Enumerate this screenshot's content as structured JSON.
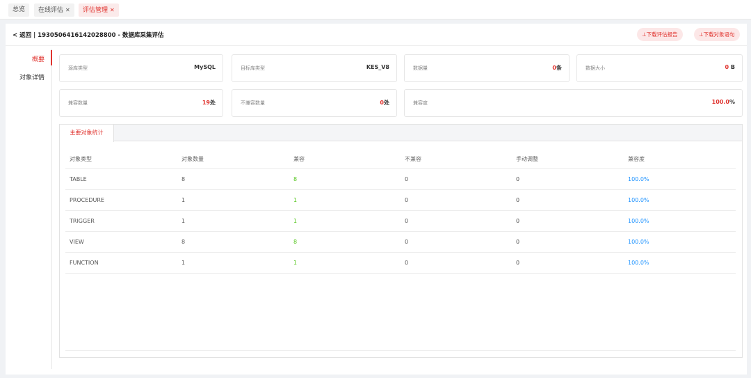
{
  "tabs": [
    {
      "label": "总览",
      "closable": false,
      "active": false
    },
    {
      "label": "在线评估",
      "closable": true,
      "active": false
    },
    {
      "label": "评估管理",
      "closable": true,
      "active": true
    }
  ],
  "header": {
    "back_label": "返回",
    "separator": "|",
    "title": "1930506416142028800 - 数据库采集评估",
    "buttons": {
      "download_report": "⊥下载评估报告",
      "download_objects": "⊥下载对象语句"
    }
  },
  "nav": {
    "items": [
      {
        "label": "概要",
        "active": true
      },
      {
        "label": "对象详情",
        "active": false
      }
    ]
  },
  "summary": {
    "source_db_type": {
      "label": "源库类型",
      "value": "MySQL"
    },
    "target_db_type": {
      "label": "目标库类型",
      "value": "KES_V8"
    },
    "data_volume": {
      "label": "数据量",
      "number": "0",
      "unit": "条"
    },
    "data_size": {
      "label": "数据大小",
      "number": "0",
      "unit": " B"
    },
    "compatible_count": {
      "label": "兼容数量",
      "number": "19",
      "unit": "处"
    },
    "incompatible_count": {
      "label": "不兼容数量",
      "number": "0",
      "unit": "处"
    },
    "compatibility": {
      "label": "兼容度",
      "number": "100.0",
      "unit": "%"
    }
  },
  "stats": {
    "tab_label": "主要对象统计",
    "columns": [
      "对象类型",
      "对象数量",
      "兼容",
      "不兼容",
      "手动调整",
      "兼容度"
    ],
    "rows": [
      [
        "TABLE",
        "8",
        "8",
        "0",
        "0",
        "100.0%"
      ],
      [
        "PROCEDURE",
        "1",
        "1",
        "0",
        "0",
        "100.0%"
      ],
      [
        "TRIGGER",
        "1",
        "1",
        "0",
        "0",
        "100.0%"
      ],
      [
        "VIEW",
        "8",
        "8",
        "0",
        "0",
        "100.0%"
      ],
      [
        "FUNCTION",
        "1",
        "1",
        "0",
        "0",
        "100.0%"
      ]
    ]
  },
  "colors": {
    "accent": "#e0342f",
    "compatible": "#52c41a",
    "percent": "#1890ff"
  }
}
